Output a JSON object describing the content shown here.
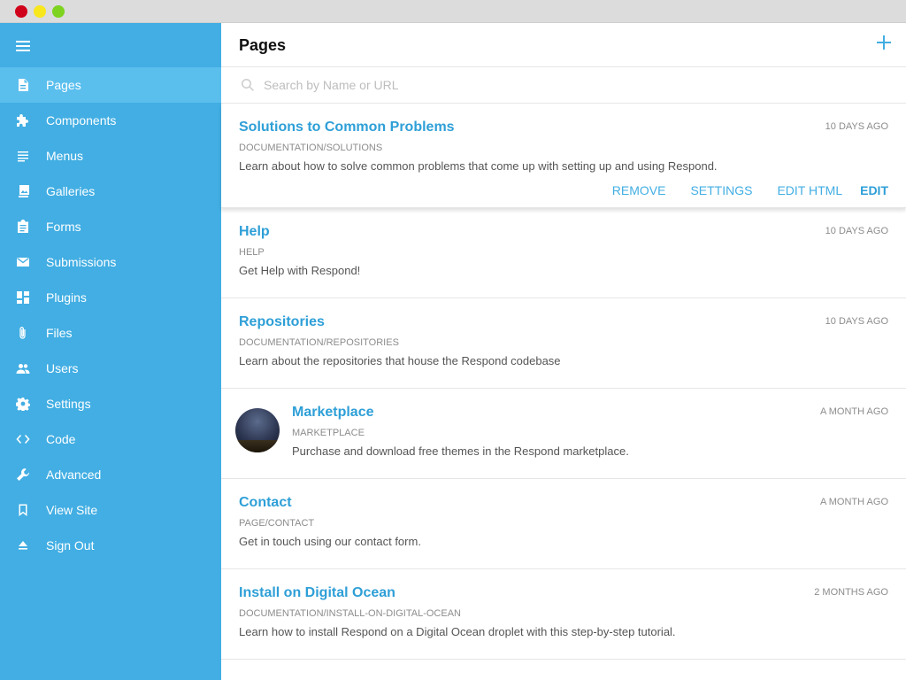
{
  "window": {
    "colors": {
      "close": "#d0021b",
      "minimize": "#f8e71c",
      "zoom": "#7ed321"
    }
  },
  "colors": {
    "sidebar": "#42aee3",
    "sidebar_active": "#5bbfee",
    "link": "#2e9fd7"
  },
  "sidebar": {
    "menu_icon": "hamburger-icon",
    "items": [
      {
        "label": "Pages",
        "icon": "page-icon",
        "active": true
      },
      {
        "label": "Components",
        "icon": "puzzle-icon"
      },
      {
        "label": "Menus",
        "icon": "list-icon"
      },
      {
        "label": "Galleries",
        "icon": "gallery-icon"
      },
      {
        "label": "Forms",
        "icon": "clipboard-icon"
      },
      {
        "label": "Submissions",
        "icon": "mail-icon"
      },
      {
        "label": "Plugins",
        "icon": "dashboard-icon"
      },
      {
        "label": "Files",
        "icon": "paperclip-icon"
      },
      {
        "label": "Users",
        "icon": "users-icon"
      },
      {
        "label": "Settings",
        "icon": "gear-icon"
      },
      {
        "label": "Code",
        "icon": "code-icon"
      },
      {
        "label": "Advanced",
        "icon": "wrench-icon"
      },
      {
        "label": "View Site",
        "icon": "bookmark-icon"
      },
      {
        "label": "Sign Out",
        "icon": "eject-icon"
      }
    ]
  },
  "header": {
    "title": "Pages",
    "add_icon": "plus-icon"
  },
  "search": {
    "placeholder": "Search by Name or URL",
    "value": ""
  },
  "pages": [
    {
      "title": "Solutions to Common Problems",
      "url": "DOCUMENTATION/SOLUTIONS",
      "description": "Learn about how to solve common problems that come up with setting up and using Respond.",
      "time": "10 DAYS AGO"
    },
    {
      "title": "Help",
      "url": "HELP",
      "description": "Get Help with Respond!",
      "time": "10 DAYS AGO"
    },
    {
      "title": "Repositories",
      "url": "DOCUMENTATION/REPOSITORIES",
      "description": "Learn about the repositories that house the Respond codebase",
      "time": "10 DAYS AGO"
    },
    {
      "title": "Marketplace",
      "url": "MARKETPLACE",
      "description": "Purchase and download free themes in the Respond marketplace.",
      "time": "A MONTH AGO"
    },
    {
      "title": "Contact",
      "url": "PAGE/CONTACT",
      "description": "Get in touch using our contact form.",
      "time": "A MONTH AGO"
    },
    {
      "title": "Install on Digital Ocean",
      "url": "DOCUMENTATION/INSTALL-ON-DIGITAL-OCEAN",
      "description": "Learn how to install Respond on a Digital Ocean droplet with this step-by-step tutorial.",
      "time": "2 MONTHS AGO"
    }
  ],
  "row_actions": {
    "remove": "REMOVE",
    "settings": "SETTINGS",
    "edit_html": "EDIT HTML",
    "edit": "EDIT"
  }
}
